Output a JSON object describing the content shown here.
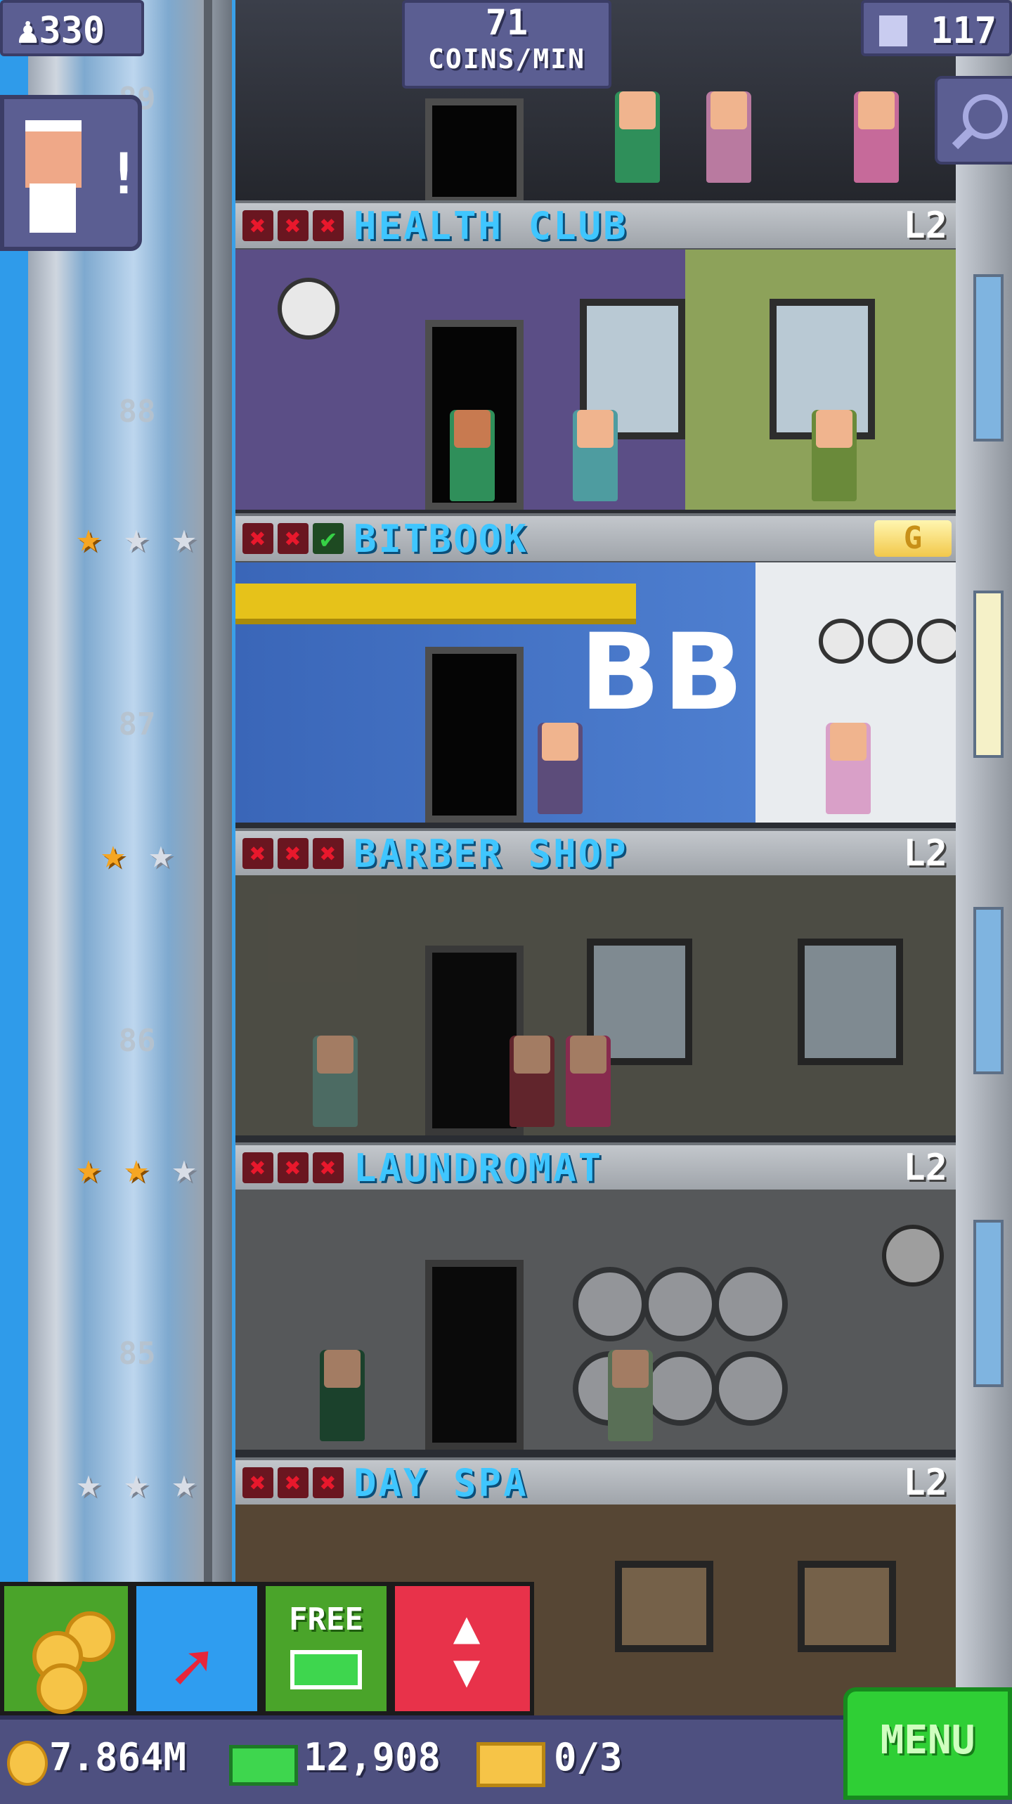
{
  "hud": {
    "population": "330",
    "coins_per_min_value": "71",
    "coins_per_min_label": "COINS/MIN",
    "floor_count": "117"
  },
  "floor_numbers": [
    "89",
    "88",
    "87",
    "86",
    "85"
  ],
  "floors": [
    {
      "name": "HEALTH CLUB",
      "level": "L2",
      "stock": [
        "x",
        "x",
        "x"
      ],
      "stars": null
    },
    {
      "name": "BITBOOK",
      "level": "G",
      "stock": [
        "x",
        "x",
        "ok"
      ],
      "stars": [
        1,
        0,
        0
      ]
    },
    {
      "name": "BARBER SHOP",
      "level": "L2",
      "stock": [
        "x",
        "x",
        "x"
      ],
      "stars": [
        1,
        0
      ]
    },
    {
      "name": "LAUNDROMAT",
      "level": "L2",
      "stock": [
        "x",
        "x",
        "x"
      ],
      "stars": [
        1,
        1,
        0
      ]
    },
    {
      "name": "DAY SPA",
      "level": "L2",
      "stock": [
        "x",
        "x",
        "x"
      ],
      "stars": [
        0,
        0,
        0
      ]
    }
  ],
  "room_art": {
    "bitbook_logo": "BB"
  },
  "buttons": {
    "free_label": "FREE",
    "menu_label": "MENU"
  },
  "currency": {
    "coins": "7.864M",
    "bux": "12,908",
    "tickets": "0/3"
  },
  "icons": {
    "population": "person-icon",
    "floors": "building-icon",
    "search": "magnifier-icon",
    "coins": "coins-icon",
    "pin": "arrow-pin-icon",
    "elevator": "up-down-arrows-icon"
  },
  "colors": {
    "hud_bg": "#5b5e92",
    "floor_name": "#3fc6ff",
    "stock_missing": "#e8182c",
    "stock_ok": "#36d146",
    "menu_green": "#2fcf35",
    "elevator_red": "#e8324a"
  }
}
